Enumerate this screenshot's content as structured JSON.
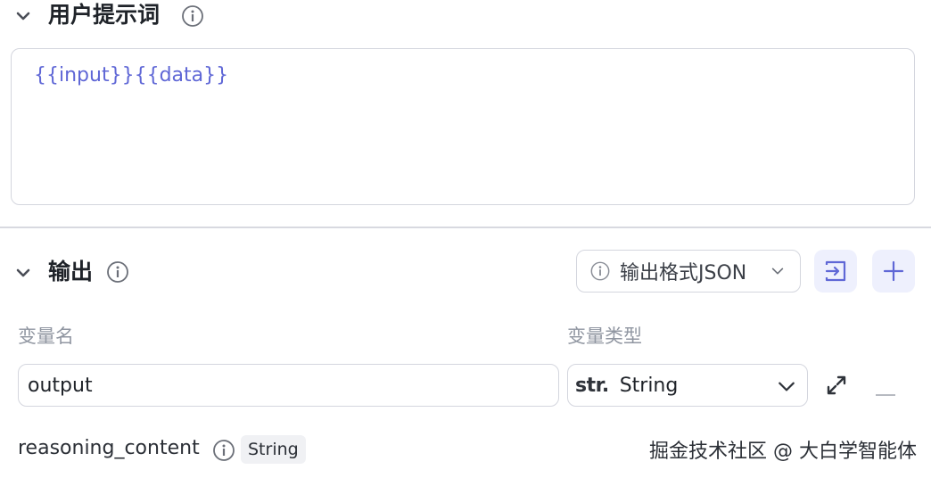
{
  "user_prompt": {
    "title": "用户提示词",
    "content": "{{input}}{{data}}"
  },
  "output": {
    "title": "输出",
    "format_select": "输出格式JSON",
    "columns": {
      "name": "变量名",
      "type": "变量类型"
    },
    "variable": {
      "name": "output",
      "type_tag": "str.",
      "type_label": "String"
    },
    "extra_field": {
      "name": "reasoning_content",
      "type": "String"
    }
  },
  "icons": {
    "collapse": "chevron-down-icon",
    "info": "info-icon",
    "import": "import-icon",
    "add": "plus-icon",
    "expand": "expand-icon",
    "remove": "minus-icon"
  },
  "colors": {
    "accent": "#5f67d6",
    "button_bg": "#eef0fd",
    "border": "#d4d6de"
  },
  "watermark": "掘金技术社区 @ 大白学智能体"
}
